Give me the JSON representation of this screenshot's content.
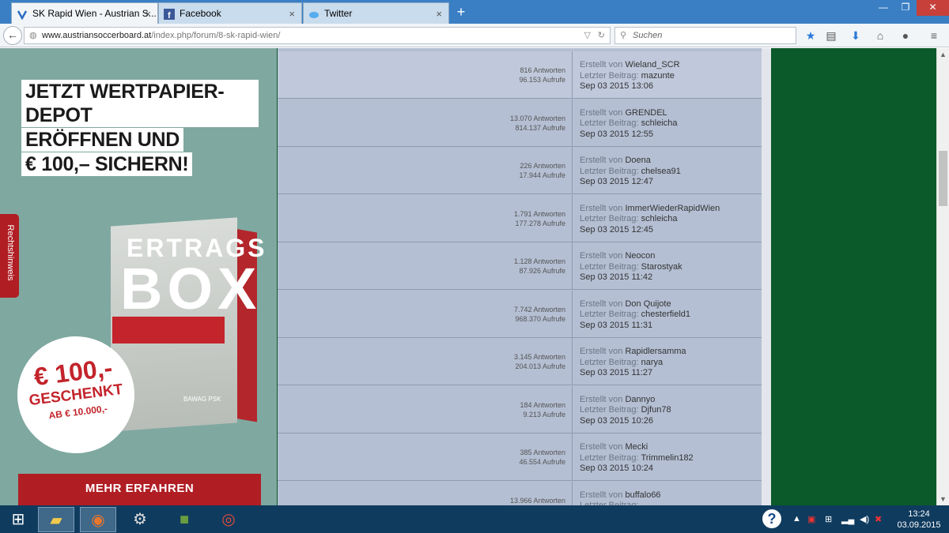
{
  "browser": {
    "tabs": [
      {
        "label": "SK Rapid Wien - Austrian S...",
        "icon": "rapid-favicon"
      },
      {
        "label": "Facebook",
        "icon": "facebook-favicon"
      },
      {
        "label": "Twitter",
        "icon": "twitter-favicon"
      }
    ],
    "new_tab": "+",
    "close": "×",
    "url_host": "www.austriansoccerboard.at",
    "url_path": "/index.php/forum/8-sk-rapid-wien/",
    "search_placeholder": "Suchen"
  },
  "ad": {
    "headline": [
      "JETZT WERTPAPIER-DEPOT",
      "ERÖFFNEN UND",
      "€ 100,– SICHERN!"
    ],
    "box_title_1": "ERTRAGS",
    "box_title_2": "BOX",
    "box_logo": "BAWAG PSK",
    "badge_amount": "€ 100,-",
    "badge_text": "GESCHENKT",
    "badge_sub": "AB € 10.000,-",
    "cta": "MEHR ERFAHREN",
    "legal_tab": "Rechtshinweis"
  },
  "forum": {
    "label_created": "Erstellt von",
    "label_last": "Letzter Beitrag:",
    "threads": [
      {
        "answers": "816 Antworten",
        "views": "96.153 Aufrufe",
        "author": "Wieland_SCR",
        "last": "mazunte",
        "date": "Sep 03 2015 13:06"
      },
      {
        "answers": "13.070 Antworten",
        "views": "814.137 Aufrufe",
        "author": "GRENDEL",
        "last": "schleicha",
        "date": "Sep 03 2015 12:55"
      },
      {
        "answers": "226 Antworten",
        "views": "17.944 Aufrufe",
        "author": "Doena",
        "last": "chelsea91",
        "date": "Sep 03 2015 12:47"
      },
      {
        "answers": "1.791 Antworten",
        "views": "177.278 Aufrufe",
        "author": "ImmerWiederRapidWien",
        "last": "schleicha",
        "date": "Sep 03 2015 12:45"
      },
      {
        "answers": "1.128 Antworten",
        "views": "87.926 Aufrufe",
        "author": "Neocon",
        "last": "Starostyak",
        "date": "Sep 03 2015 11:42"
      },
      {
        "answers": "7.742 Antworten",
        "views": "968.370 Aufrufe",
        "author": "Don Quijote",
        "last": "chesterfield1",
        "date": "Sep 03 2015 11:31"
      },
      {
        "answers": "3.145 Antworten",
        "views": "204.013 Aufrufe",
        "author": "Rapidlersamma",
        "last": "narya",
        "date": "Sep 03 2015 11:27"
      },
      {
        "answers": "184 Antworten",
        "views": "9.213 Aufrufe",
        "author": "Dannyo",
        "last": "Djfun78",
        "date": "Sep 03 2015 10:26"
      },
      {
        "answers": "385 Antworten",
        "views": "46.554 Aufrufe",
        "author": "Mecki",
        "last": "Trimmelin182",
        "date": "Sep 03 2015 10:24"
      },
      {
        "answers": "13.966 Antworten",
        "views": "",
        "author": "buffalo66",
        "last": "",
        "date": ""
      }
    ]
  },
  "taskbar": {
    "time": "13:24",
    "date": "03.09.2015"
  },
  "colors": {
    "tabbar": "#3a7fc4",
    "forum_bg": "#b4bfd3",
    "right_panel": "#0b5a2a",
    "ad_red": "#b01e24"
  }
}
